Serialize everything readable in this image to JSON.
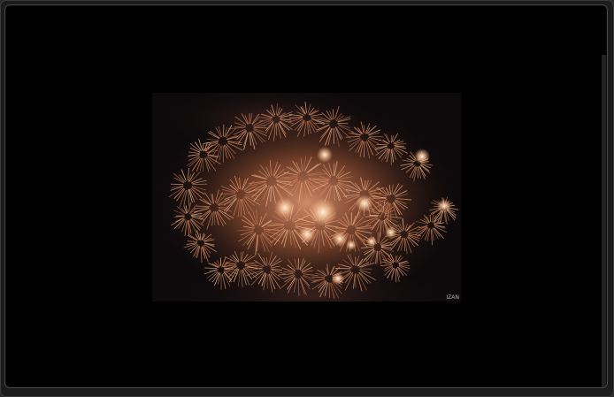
{
  "viewer": {
    "background": "#000000",
    "frame_color": "#1c1c1c",
    "border_color": "#454545"
  },
  "image": {
    "subject": "fireworks-photo",
    "palette": [
      "#0e0a0b",
      "#f2a576",
      "#ffe6c8",
      "#c8693e"
    ],
    "watermark_text": "IZAN"
  }
}
